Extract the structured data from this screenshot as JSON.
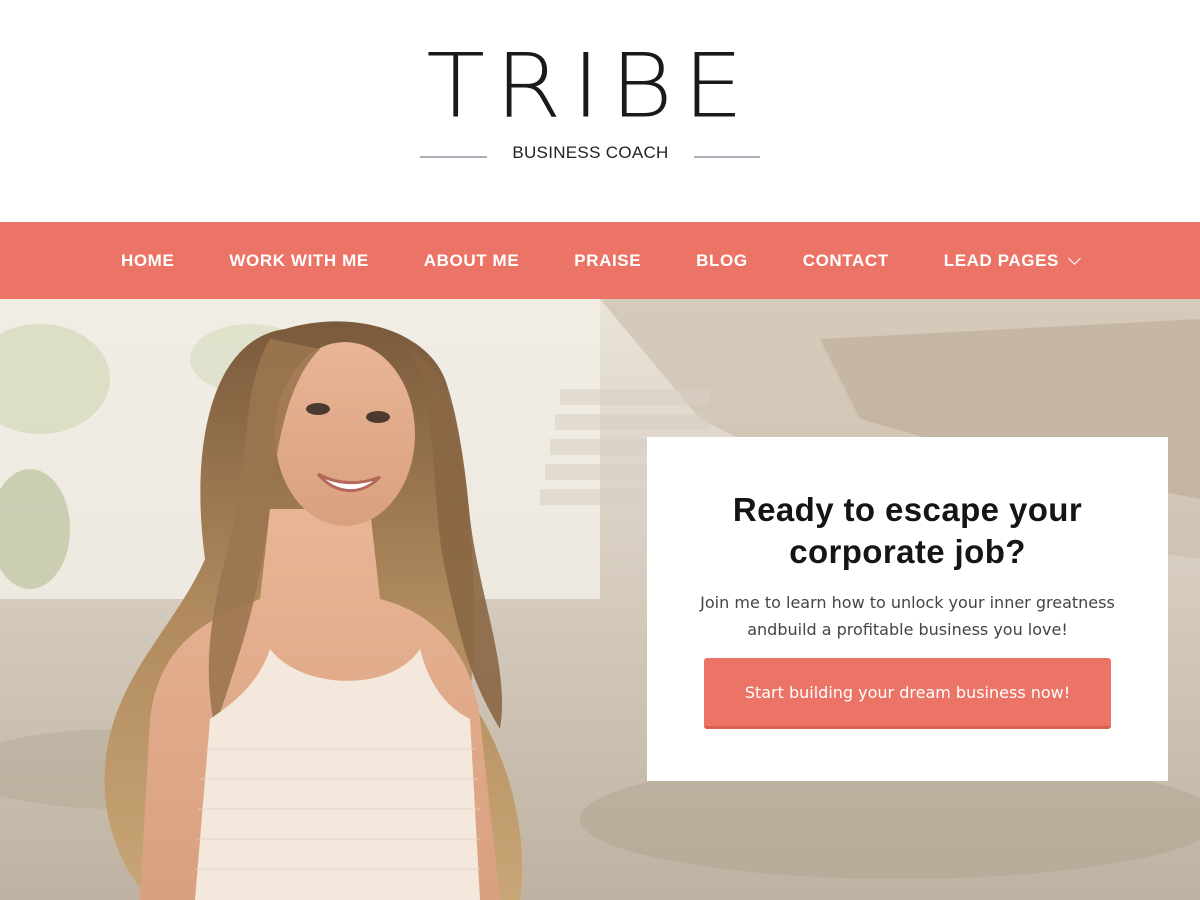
{
  "logo": {
    "wordmark": "TRIBE",
    "tagline": "BUSINESS COACH"
  },
  "nav": {
    "items": [
      {
        "label": "HOME"
      },
      {
        "label": "WORK WITH ME"
      },
      {
        "label": "ABOUT ME"
      },
      {
        "label": "PRAISE"
      },
      {
        "label": "BLOG"
      },
      {
        "label": "CONTACT"
      },
      {
        "label": "LEAD PAGES",
        "icon": "chevron-down-icon"
      }
    ]
  },
  "hero": {
    "image": "smiling-woman-outdoors-photo",
    "cta": {
      "title": "Ready to escape your corporate job?",
      "text": "Join me to learn how to unlock your inner greatness andbuild a profitable business you love!",
      "button_label": "Start building your dream business now!"
    }
  },
  "colors": {
    "accent": "#ec7467",
    "white": "#ffffff",
    "text_dark": "#151515"
  }
}
